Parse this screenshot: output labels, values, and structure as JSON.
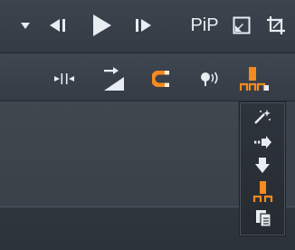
{
  "colors": {
    "accent": "#f58a1f",
    "icon": "#e8edf2",
    "bg": "#3a4048"
  },
  "transport": {
    "buttons": [
      {
        "name": "dropdown-arrow-icon"
      },
      {
        "name": "previous-frame-icon"
      },
      {
        "name": "play-icon"
      },
      {
        "name": "next-frame-icon"
      }
    ],
    "pip_label": "PiP"
  },
  "timeline_toolbar": {
    "items": [
      {
        "name": "split-icon"
      },
      {
        "name": "insert-clip-icon"
      },
      {
        "name": "magnet-snap-icon"
      },
      {
        "name": "audio-scrub-icon"
      },
      {
        "name": "placement-mode-icon"
      }
    ]
  },
  "placement_menu": {
    "items": [
      {
        "name": "smart-insert-icon"
      },
      {
        "name": "insert-right-icon"
      },
      {
        "name": "insert-down-icon"
      },
      {
        "name": "overwrite-mode-icon"
      },
      {
        "name": "paste-icon"
      }
    ]
  }
}
